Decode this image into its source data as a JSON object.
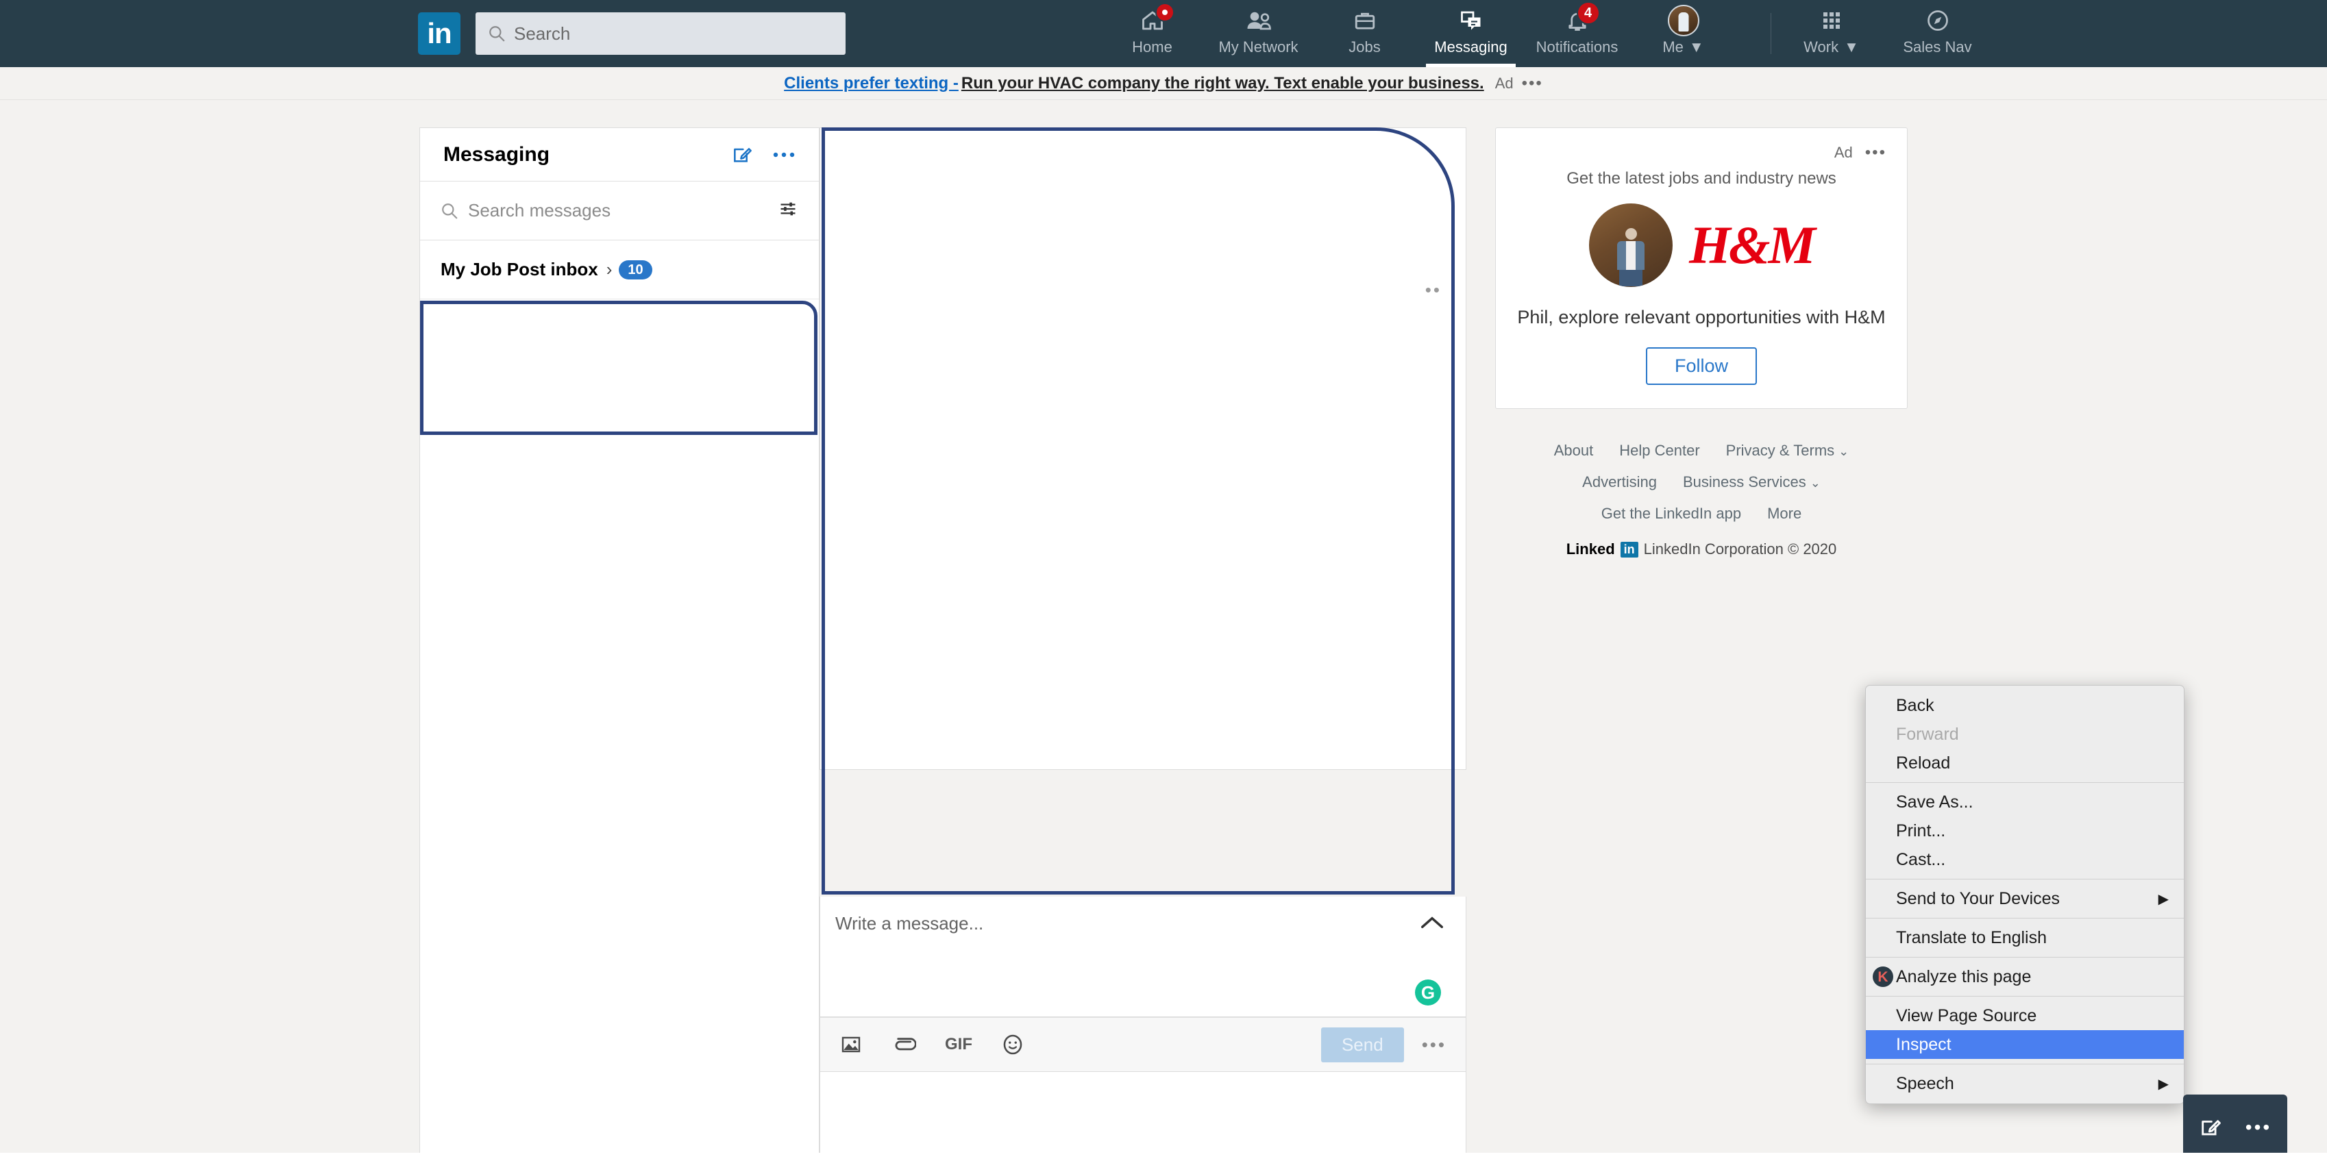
{
  "topnav": {
    "logo": "in",
    "logo_icon": "linkedin-logo-icon",
    "search": {
      "placeholder": "Search",
      "value": "",
      "icon": "search-icon"
    },
    "items": [
      {
        "label": "Home",
        "icon": "home-icon",
        "badge": "",
        "badge_type": "dot",
        "active": false
      },
      {
        "label": "My Network",
        "icon": "network-icon",
        "badge": "",
        "badge_type": "",
        "active": false
      },
      {
        "label": "Jobs",
        "icon": "briefcase-icon",
        "badge": "",
        "badge_type": "",
        "active": false
      },
      {
        "label": "Messaging",
        "icon": "messaging-icon",
        "badge": "",
        "badge_type": "",
        "active": true
      },
      {
        "label": "Notifications",
        "icon": "bell-icon",
        "badge": "4",
        "badge_type": "count",
        "active": false
      }
    ],
    "me": {
      "label": "Me",
      "icon": "avatar-icon",
      "caret": "▼"
    },
    "work": {
      "label": "Work",
      "icon": "grid-icon",
      "caret": "▼"
    },
    "sales_nav": {
      "label": "Sales Nav",
      "icon": "compass-icon"
    }
  },
  "ad_banner": {
    "link_text": "Clients prefer texting -",
    "body_text": "Run your HVAC company the right way. Text enable your business.",
    "tag": "Ad",
    "more": "•••"
  },
  "conversations": {
    "title": "Messaging",
    "compose_icon": "compose-icon",
    "more_icon": "more-options-icon",
    "search": {
      "placeholder": "Search messages",
      "value": "",
      "icon": "search-icon",
      "filter_icon": "filter-icon"
    },
    "job_post_inbox": {
      "label": "My Job Post inbox",
      "chevron": "›",
      "badge": "10"
    },
    "selected_item": {
      "label": ""
    }
  },
  "thread": {
    "more_icon": "more-options-icon",
    "more_dots": "••",
    "composer": {
      "placeholder": "Write a message...",
      "value": "",
      "collapse_icon": "chevron-up-icon",
      "grammarly_icon": "grammarly-icon",
      "grammarly_letter": "G"
    },
    "toolbar": {
      "image_icon": "image-icon",
      "attach_icon": "attachment-icon",
      "gif_label": "GIF",
      "gif_icon": "gif-icon",
      "emoji_icon": "emoji-icon",
      "send_label": "Send",
      "more": "•••"
    }
  },
  "ad_card": {
    "tag": "Ad",
    "more": "•••",
    "subtitle": "Get the latest jobs and industry news",
    "avatar_icon": "user-avatar-icon",
    "brand_logo": "hm-logo-icon",
    "brand_text": "H&M",
    "headline": "Phil, explore relevant opportunities with H&M",
    "follow_label": "Follow",
    "brand_color": "#e50010"
  },
  "footer": {
    "rows": [
      [
        {
          "label": "About",
          "chevron": ""
        },
        {
          "label": "Help Center",
          "chevron": ""
        },
        {
          "label": "Privacy & Terms",
          "chevron": "⌄"
        }
      ],
      [
        {
          "label": "Advertising",
          "chevron": ""
        },
        {
          "label": "Business Services",
          "chevron": "⌄"
        }
      ],
      [
        {
          "label": "Get the LinkedIn app",
          "chevron": ""
        },
        {
          "label": "More",
          "chevron": ""
        }
      ]
    ],
    "copyright": {
      "brand": "Linked",
      "badge": "in",
      "text": "LinkedIn Corporation © 2020"
    }
  },
  "context_menu": {
    "groups": [
      [
        {
          "label": "Back",
          "state": "normal",
          "submenu": false,
          "icon": ""
        },
        {
          "label": "Forward",
          "state": "disabled",
          "submenu": false,
          "icon": ""
        },
        {
          "label": "Reload",
          "state": "normal",
          "submenu": false,
          "icon": ""
        }
      ],
      [
        {
          "label": "Save As...",
          "state": "normal",
          "submenu": false,
          "icon": ""
        },
        {
          "label": "Print...",
          "state": "normal",
          "submenu": false,
          "icon": ""
        },
        {
          "label": "Cast...",
          "state": "normal",
          "submenu": false,
          "icon": ""
        }
      ],
      [
        {
          "label": "Send to Your Devices",
          "state": "normal",
          "submenu": true,
          "icon": ""
        }
      ],
      [
        {
          "label": "Translate to English",
          "state": "normal",
          "submenu": false,
          "icon": ""
        }
      ],
      [
        {
          "label": "Analyze this page",
          "state": "normal",
          "submenu": false,
          "icon": "k-badge-icon",
          "icon_letter": "K"
        }
      ],
      [
        {
          "label": "View Page Source",
          "state": "normal",
          "submenu": false,
          "icon": ""
        },
        {
          "label": "Inspect",
          "state": "selected",
          "submenu": false,
          "icon": ""
        }
      ],
      [
        {
          "label": "Speech",
          "state": "normal",
          "submenu": true,
          "icon": ""
        }
      ]
    ],
    "submenu_arrow": "▶",
    "selected_color": "#4a7ff0"
  },
  "message_overlay": {
    "compose_icon": "compose-icon",
    "more": "•••"
  },
  "colors": {
    "nav_bg": "#283e4a",
    "accent_blue": "#0b65c2",
    "selection_outline": "#2d4480",
    "badge_red": "#cc1016",
    "grammarly_green": "#15c39a"
  }
}
